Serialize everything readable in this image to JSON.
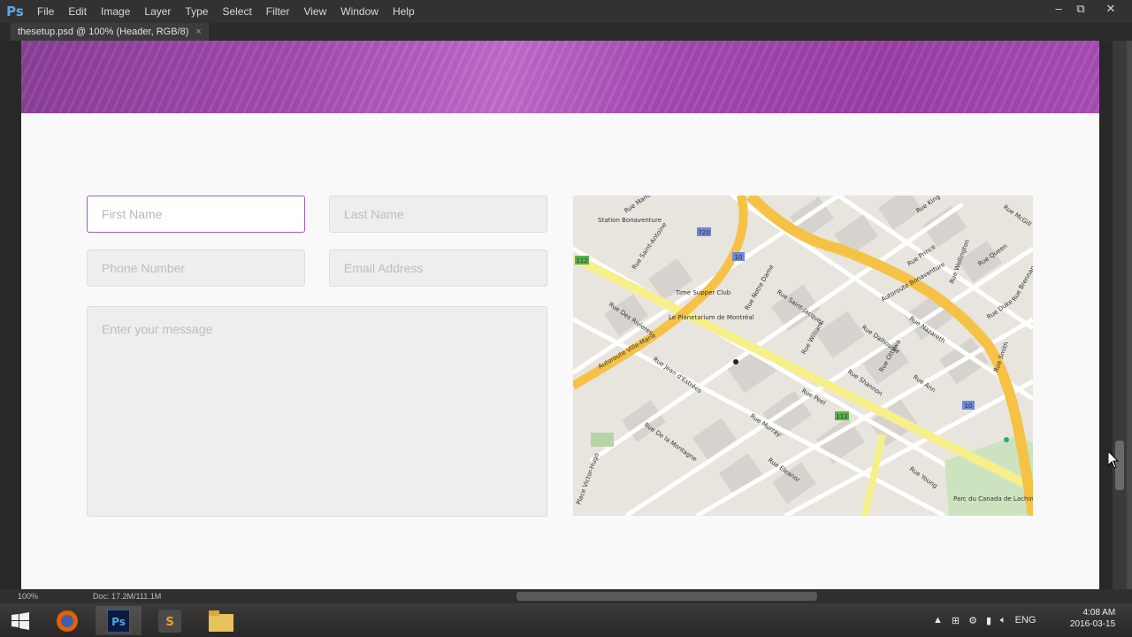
{
  "app": {
    "logo": "Ps"
  },
  "menu": [
    "File",
    "Edit",
    "Image",
    "Layer",
    "Type",
    "Select",
    "Filter",
    "View",
    "Window",
    "Help"
  ],
  "window_controls": {
    "minimize": "–",
    "restore": "⧉",
    "close": "✕"
  },
  "doc_tab": {
    "title": "thesetup.psd @ 100% (Header, RGB/8)",
    "close": "×"
  },
  "form": {
    "first_name": "First Name",
    "last_name": "Last Name",
    "phone": "Phone Number",
    "email": "Email Address",
    "message": "Enter your message"
  },
  "map": {
    "labels": [
      "Station Bonaventure",
      "Rue Mansfield",
      "Rue Saint-Antoine",
      "Rue Des Rivieres",
      "Le Planetarium de Montréal",
      "Time Supper Club",
      "Autoroute Ville-Marie",
      "Rue Jean d'Estrées",
      "Rue Peel",
      "Autoroute Bonaventure",
      "Rue Wellington",
      "Rue Ottawa",
      "Rue Notre Dame",
      "Rue Saint-Jacques",
      "Rue William",
      "Rue Dalhousie",
      "Rue King",
      "Rue Prince",
      "Rue Queen",
      "Rue Smith",
      "Rue Duke",
      "Rue Brennan",
      "Rue Murray",
      "Rue De la Montagne",
      "Rue Eleanor",
      "Rue Young",
      "Rue Shannon",
      "Rue Nazareth",
      "Rue Ann",
      "Rue McGill",
      "Parc du Canada de Lachine",
      "Place Victor-Hugo"
    ],
    "badges": [
      "720",
      "10",
      "112",
      "136"
    ]
  },
  "status": {
    "zoom": "100%",
    "doc": "Doc: 17.2M/111.1M"
  },
  "taskbar": {
    "lang": "ENG",
    "time": "4:08 AM",
    "date": "2016-03-15"
  }
}
